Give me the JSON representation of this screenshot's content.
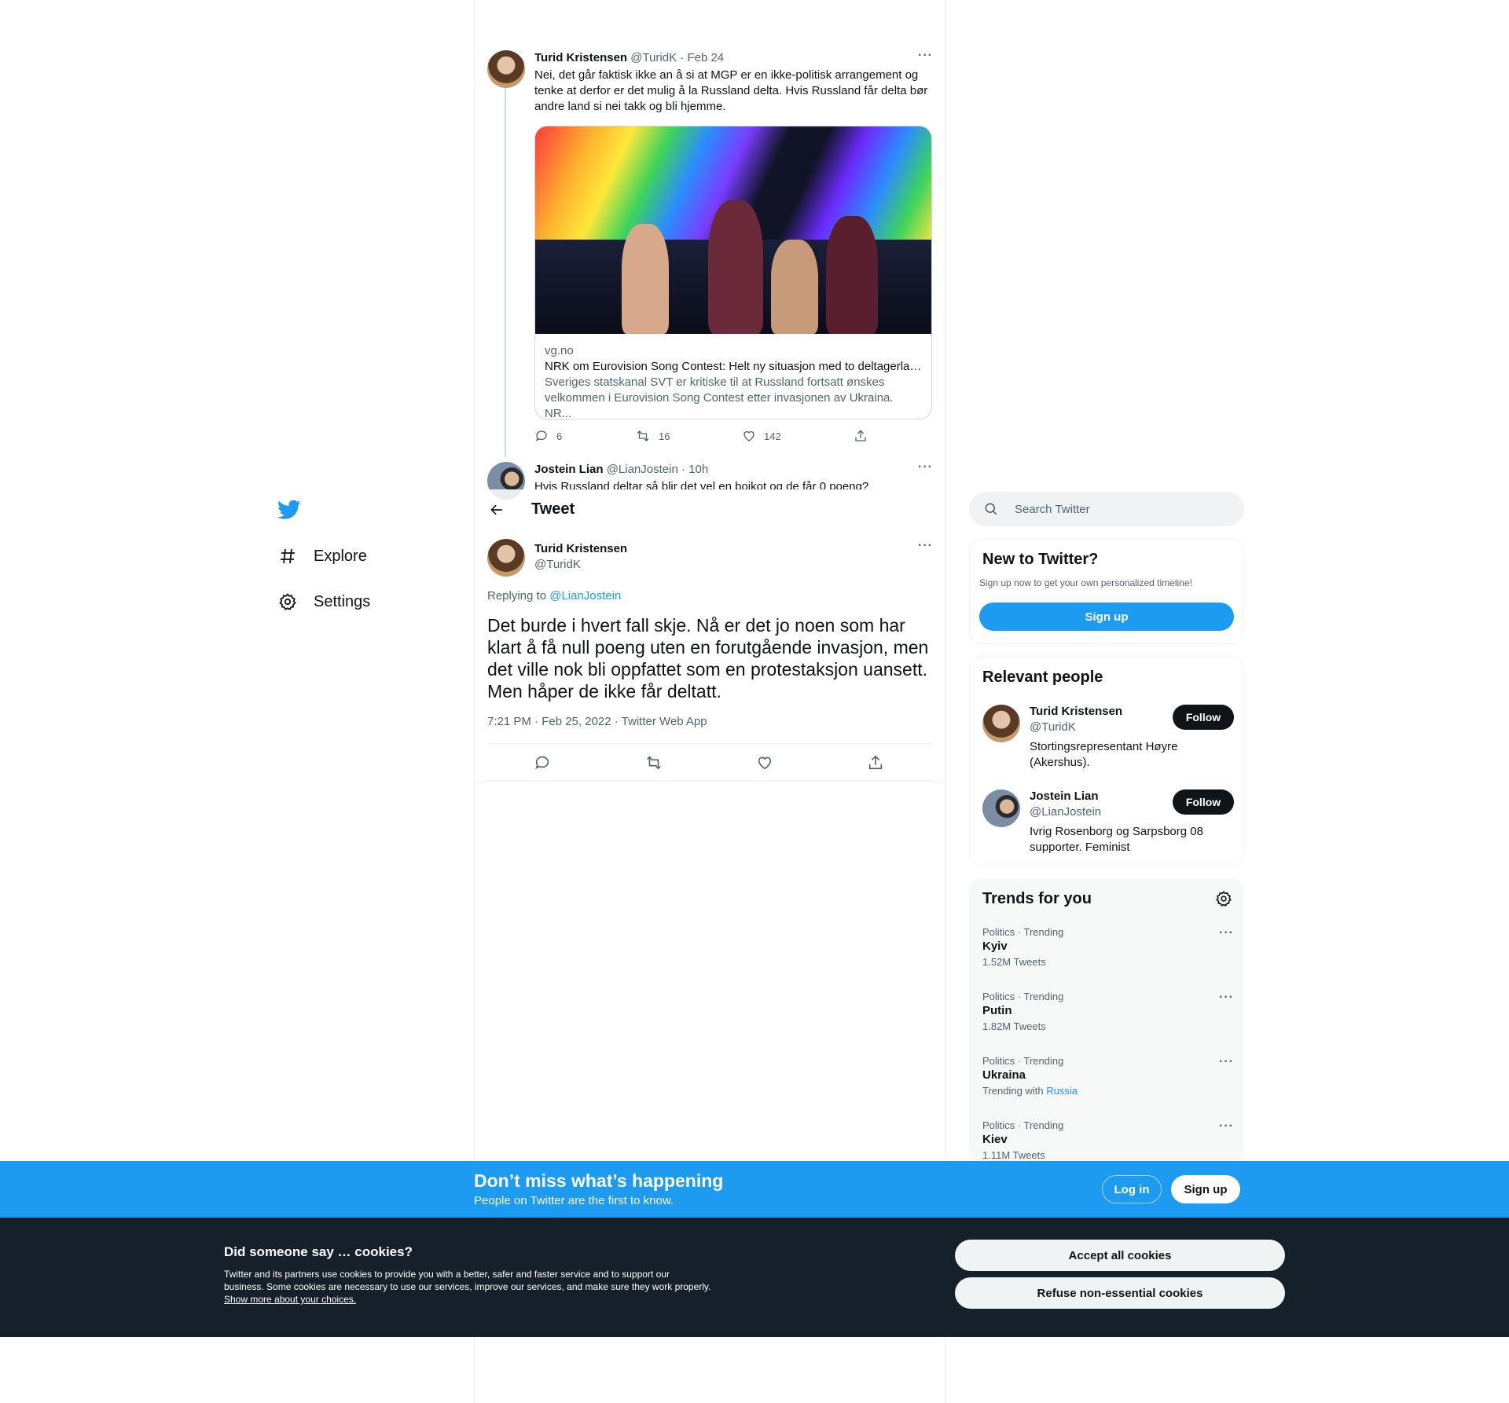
{
  "nav": {
    "items": [
      {
        "label": "Explore",
        "icon": "hashtag-icon"
      },
      {
        "label": "Settings",
        "icon": "gear-icon"
      }
    ]
  },
  "header": {
    "title": "Tweet"
  },
  "prev_tweet": {
    "name": "Turid Kristensen",
    "handle": "@TuridK",
    "date": "· Feb 24",
    "text": "Nei, det går faktisk ikke an å si at MGP er en ikke-politisk arrangement og tenke at derfor er det mulig å la Russland delta. Hvis Russland får delta bør andre land si nei takk og bli hjemme.",
    "card": {
      "domain": "vg.no",
      "title": "NRK om Eurovision Song Contest: Helt ny situasjon med to deltagerlan...",
      "description": "Sveriges statskanal SVT er kritiske til at Russland fortsatt ønskes velkommen i Eurovision Song Contest etter invasjonen av Ukraina. NR..."
    },
    "replies": "6",
    "retweets": "16",
    "likes": "142"
  },
  "partial_tweet": {
    "name": "Jostein Lian",
    "handle": "@LianJostein",
    "date": "· 10h",
    "text": "Hvis Russland deltar så blir det vel en boikot og de får 0 poeng?"
  },
  "main_tweet": {
    "name": "Turid Kristensen",
    "handle": "@TuridK",
    "replying_prefix": "Replying to",
    "replying_to": "@LianJostein",
    "text": "Det burde i hvert fall skje. Nå er det jo noen som har klart å få null poeng uten en forutgående invasjon, men det ville nok bli oppfattet som en protestaksjon uansett. Men håper de ikke får deltatt.",
    "meta": "7:21 PM · Feb 25, 2022 · Twitter Web App"
  },
  "search": {
    "placeholder": "Search Twitter"
  },
  "new_to_twitter": {
    "title": "New to Twitter?",
    "subtitle": "Sign up now to get your own personalized timeline!",
    "button": "Sign up"
  },
  "relevant_people": {
    "title": "Relevant people",
    "people": [
      {
        "name": "Turid Kristensen",
        "handle": "@TuridK",
        "bio": "Stortingsrepresentant Høyre (Akershus).",
        "button": "Follow"
      },
      {
        "name": "Jostein Lian",
        "handle": "@LianJostein",
        "bio": "Ivrig Rosenborg og Sarpsborg 08 supporter. Feminist",
        "button": "Follow"
      }
    ]
  },
  "trends": {
    "title": "Trends for you",
    "items": [
      {
        "category": "Politics · Trending",
        "name": "Kyiv",
        "count": "1.52M Tweets"
      },
      {
        "category": "Politics · Trending",
        "name": "Putin",
        "count": "1.82M Tweets"
      },
      {
        "category": "Politics · Trending",
        "name": "Ukraina",
        "count": "Trending with",
        "with": "Russia"
      },
      {
        "category": "Politics · Trending",
        "name": "Kiev",
        "count": "1.11M Tweets"
      }
    ]
  },
  "banner": {
    "title": "Don’t miss what’s happening",
    "subtitle": "People on Twitter are the first to know.",
    "login": "Log in",
    "signup": "Sign up"
  },
  "cookies": {
    "title": "Did someone say … cookies?",
    "text": "Twitter and its partners use cookies to provide you with a better, safer and faster service and to support our business. Some cookies are necessary to use our services, improve our services, and make sure they work properly.",
    "link": "Show more about your choices.",
    "accept": "Accept all cookies",
    "refuse": "Refuse non-essential cookies"
  },
  "colors": {
    "accent": "#1d9bf0",
    "text": "#0f1419",
    "muted": "#536471",
    "cookie_bg": "#15202b"
  }
}
